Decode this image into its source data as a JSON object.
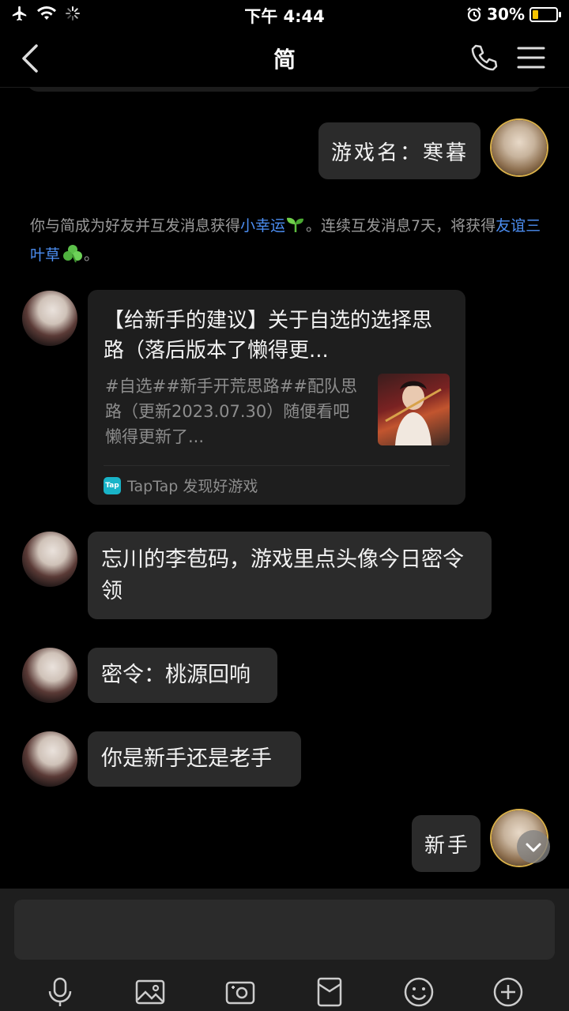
{
  "status_bar": {
    "time": "下午 4:44",
    "battery": "30%",
    "battery_level": 0.3
  },
  "header": {
    "title": "简"
  },
  "messages": {
    "me_1": "游戏名：寒暮",
    "system_notice": {
      "part1": "你与简成为好友并互发消息获得",
      "link1": "小幸运",
      "part2": "。连续互发消息7天，将获得",
      "link2": "友谊三叶草",
      "part3": "。"
    },
    "share_card": {
      "title": "【给新手的建议】关于自选的选择思路（落后版本了懒得更...",
      "description": "#自选##新手开荒思路##配队思路（更新2023.07.30）随便看吧懒得更新了...",
      "source": "TapTap 发现好游戏",
      "logo_text": "Tap"
    },
    "them_1": "忘川的李苞码，游戏里点头像今日密令领",
    "them_2": "密令：桃源回响",
    "them_3": "你是新手还是老手",
    "me_2": "新手"
  },
  "icons": [
    "airplane-icon",
    "wifi-icon",
    "loading-icon",
    "alarm-icon",
    "battery-icon",
    "back-icon",
    "phone-icon",
    "menu-icon",
    "sprout-icon",
    "clover-icon",
    "taptap-logo-icon",
    "chevron-down-icon",
    "microphone-icon",
    "image-icon",
    "camera-icon",
    "red-packet-icon",
    "emoji-icon",
    "plus-icon"
  ]
}
